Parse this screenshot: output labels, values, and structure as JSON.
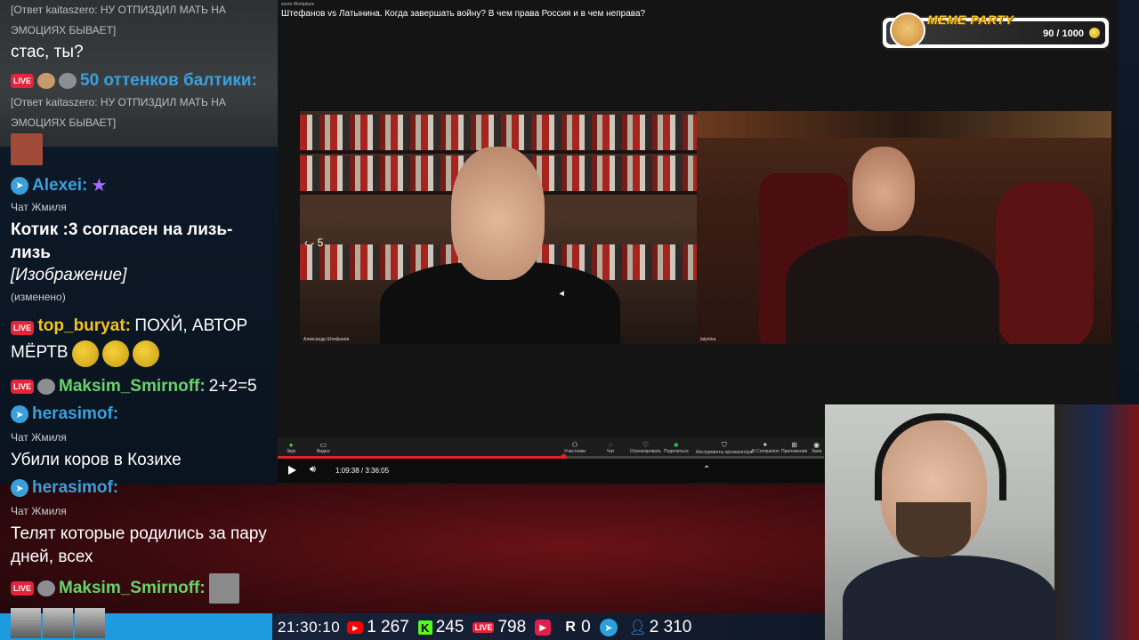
{
  "chat": {
    "msg1_reply": "[Ответ kaitaszero: НУ ОТПИЗДИЛ МАТЬ НА ЭМОЦИЯХ БЫВАЕТ]",
    "msg1_text": "стас, ты?",
    "msg2_nick": "50 оттенков балтики:",
    "msg2_reply": "[Ответ kaitaszero: НУ ОТПИЗДИЛ МАТЬ НА ЭМОЦИЯХ БЫВАЕТ]",
    "msg3_nick": "Alexei:",
    "msg3_source": "Чат Жмиля",
    "msg3_text": "Котик :3 согласен на лизь-лизь",
    "msg3_image": "[Изображение]",
    "msg3_edited": "(изменено)",
    "msg4_nick": "top_buryat:",
    "msg4_text": "ПОХЙ, АВТОР МЁРТВ",
    "msg5_nick": "Maksim_Smirnoff:",
    "msg5_text": "2+2=5",
    "msg6_nick": "herasimof:",
    "msg6_source": "Чат Жмиля",
    "msg6_text": "Убили коров в Козихе",
    "msg7_nick": "herasimof:",
    "msg7_source": "Чат Жмиля",
    "msg7_text": "Телят которые родились за пару дней, всех",
    "msg8_nick": "Maksim_Smirnoff:",
    "live_label": "LIVE"
  },
  "player": {
    "zoom_tag": "zoom Workplace",
    "title": "Штефанов vs Латынина. Когда завершать войну? В чем права Россия и в чем неправа?",
    "skip_label": "- 5",
    "left_name": "Александр Штефанов",
    "right_name": "latynina",
    "toolbar": {
      "audio": "Звук",
      "video": "Видео",
      "participants": "Участники",
      "chat": "Чат",
      "react": "Отреагировать",
      "share": "Поделиться",
      "host_tools": "Инструменты организатора",
      "ai": "AI Companion",
      "apps": "Приложения",
      "record": "Запи"
    },
    "time": "1:09:38 / 3:36:05",
    "progress": 0.523
  },
  "meme_party": {
    "title": "MEME PARTY",
    "score": "90 / 1000"
  },
  "stats": {
    "time": "21:30:10",
    "youtube": "1 267",
    "kick": "245",
    "vk_live": "798",
    "rutube": "",
    "r_count": "0",
    "total": "2 310",
    "kick_letter": "K",
    "r_letter": "R"
  },
  "colors": {
    "accent_blue": "#3aa0dc",
    "live_red": "#e5243c",
    "kick_green": "#53fc18",
    "youtube_red": "#ff0000",
    "nick_green": "#69d36a",
    "nick_blue": "#3aa0dc",
    "nick_yellow": "#f6c21c"
  }
}
